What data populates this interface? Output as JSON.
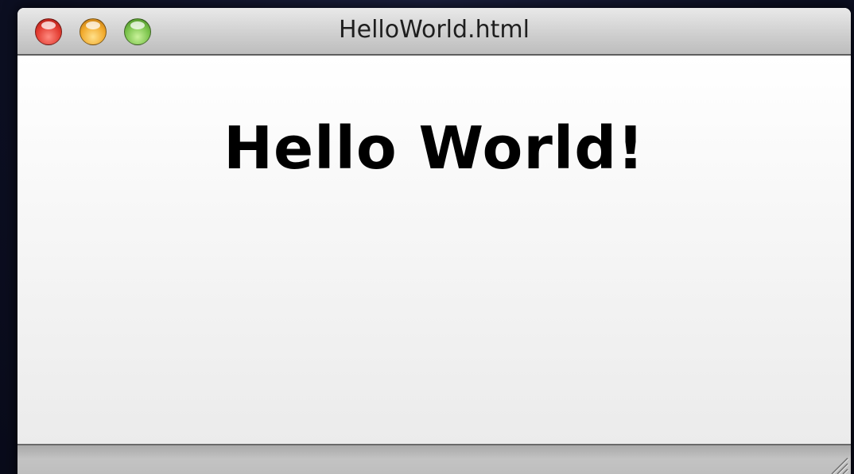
{
  "window": {
    "title": "HelloWorld.html",
    "controls": [
      {
        "name": "close",
        "color": "#e23a2f"
      },
      {
        "name": "minimize",
        "color": "#f1a92b"
      },
      {
        "name": "zoom",
        "color": "#79c24a"
      }
    ]
  },
  "page": {
    "heading": "Hello World!"
  }
}
